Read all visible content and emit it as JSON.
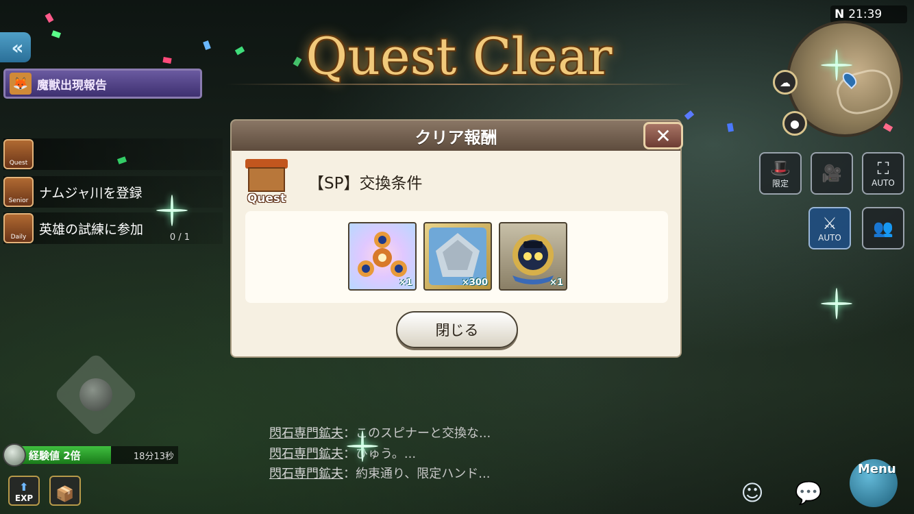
{
  "hud": {
    "clock_north": "N",
    "clock_time": "21:39",
    "quest_banner_label": "魔獣出現報告"
  },
  "side_quests": [
    {
      "icon_label": "Quest",
      "text": ""
    },
    {
      "icon_label": "Senior",
      "text": "ナムジャ川を登録"
    },
    {
      "icon_label": "Daily",
      "text": "英雄の試練に参加",
      "count": "0 / 1"
    }
  ],
  "title": "Quest Clear",
  "dialog": {
    "header": "クリア報酬",
    "close_symbol": "✕",
    "quest_icon_caption": "Quest",
    "quest_title": "【SP】交換条件",
    "rewards": [
      {
        "name": "spinner",
        "quantity": "×1"
      },
      {
        "name": "crystal",
        "quantity": "×300"
      },
      {
        "name": "emblem",
        "quantity": "×1"
      }
    ],
    "close_button_label": "閉じる"
  },
  "right_buttons": [
    {
      "name": "limited",
      "label": "限定"
    },
    {
      "name": "camera",
      "label": ""
    },
    {
      "name": "auto-target",
      "label": "AUTO"
    },
    {
      "name": "auto-battle",
      "label": "AUTO"
    },
    {
      "name": "party",
      "label": ""
    }
  ],
  "exp": {
    "label": "経験値 2倍",
    "timer": "18分13秒",
    "exp_button": "EXP"
  },
  "chat": [
    {
      "speaker": "閃石専門鉱夫",
      "message": "：このスピナーと交換な..."
    },
    {
      "speaker": "閃石専門鉱夫",
      "message": "：ひゅう。..."
    },
    {
      "speaker": "閃石専門鉱夫",
      "message": "：約束通り、限定ハンド..."
    }
  ],
  "menu_label": "Menu",
  "colors": {
    "title_gold": "#f1c97b",
    "dialog_bg": "#f6f0e2",
    "dialog_header": "#6e5a48",
    "exp_green": "#2fa02f",
    "banner_purple": "#5a4a90"
  }
}
